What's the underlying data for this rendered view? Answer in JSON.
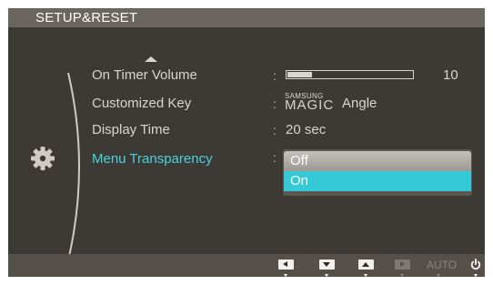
{
  "header": {
    "title": "SETUP&RESET"
  },
  "menu": {
    "items": [
      {
        "label": "On Timer  Volume"
      },
      {
        "label": "Customized Key"
      },
      {
        "label": "Display Time"
      },
      {
        "label": "Menu Transparency"
      }
    ],
    "selected": "Menu Transparency"
  },
  "values": {
    "volume": {
      "level": 10,
      "max": 100,
      "display": "10"
    },
    "customized_key": {
      "brand_small": "SAMSUNG",
      "brand_big": "MAGIC",
      "label": "Angle"
    },
    "display_time": "20 sec"
  },
  "dropdown": {
    "options": [
      "Off",
      "On"
    ],
    "highlighted": "On"
  },
  "footer": {
    "buttons": [
      "left-arrow",
      "down-arrow",
      "up-arrow",
      "right-arrow",
      "AUTO",
      "power"
    ],
    "auto_label": "AUTO"
  },
  "colors": {
    "accent": "#46d3de",
    "highlight": "#35c9d5",
    "header_bg": "#6a655e",
    "panel_bg": "#3d3934"
  }
}
